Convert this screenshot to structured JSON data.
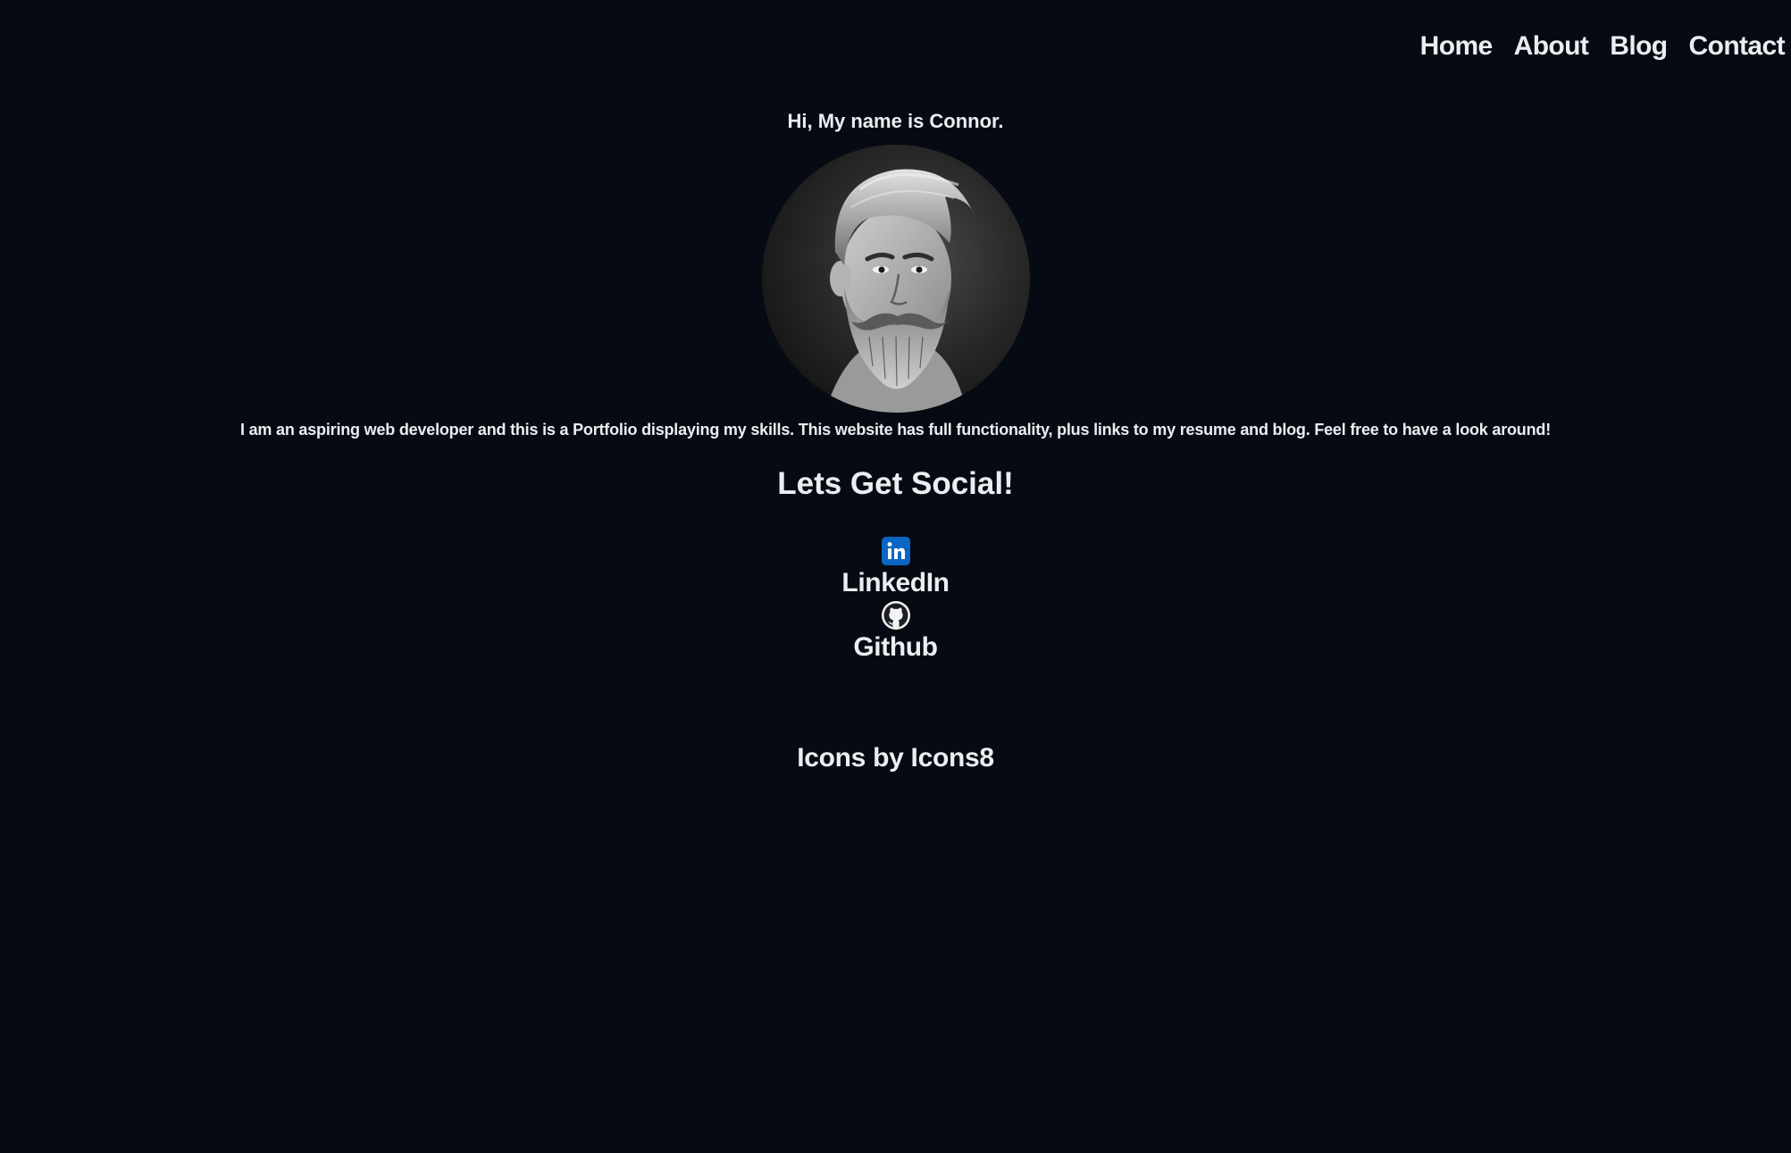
{
  "nav": {
    "items": [
      {
        "label": "Home"
      },
      {
        "label": "About"
      },
      {
        "label": "Blog"
      },
      {
        "label": "Contact"
      }
    ]
  },
  "hero": {
    "greeting": "Hi, My name is Connor.",
    "bio": "I am an aspiring web developer and this is a Portfolio displaying my skills. This website has full functionality, plus links to my resume and blog. Feel free to have a look around!"
  },
  "social": {
    "title": "Lets Get Social!",
    "items": [
      {
        "label": "LinkedIn",
        "icon": "linkedin-icon"
      },
      {
        "label": "Github",
        "icon": "github-icon"
      }
    ]
  },
  "footer": {
    "credit_prefix": "Icons by ",
    "credit_link": "Icons8"
  },
  "colors": {
    "background": "#060a13",
    "text": "#ecedf0",
    "linkedin": "#0a66c2"
  }
}
